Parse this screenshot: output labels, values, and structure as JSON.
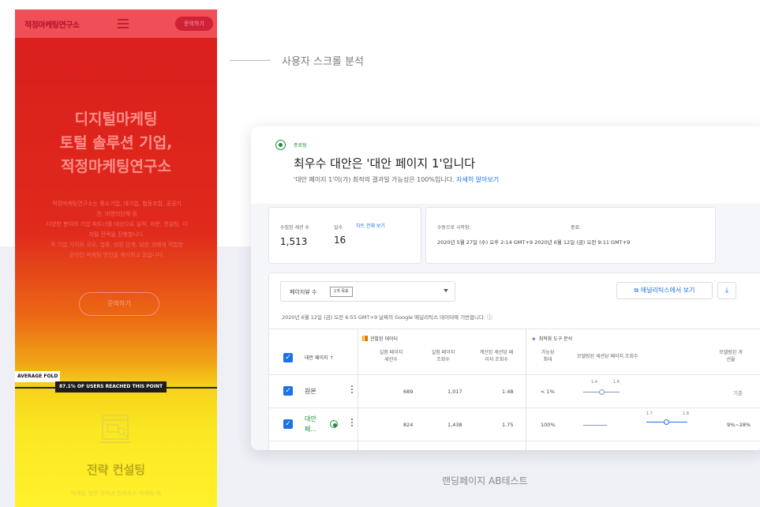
{
  "heatmap": {
    "brand": "적정마케팅연구소",
    "contact_button": "문의하기",
    "hero_lines": [
      "디지털마케팅",
      "토털 솔루션 기업,",
      "적정마케팅연구소"
    ],
    "description_lines": [
      "적정마케팅연구소는 중소기업, 대기업, 협동조합, 공공기",
      "관, 비영리단체 등",
      "다양한 분야의 기업 파트너를 대상으로 실적, 자문, 컨설팅, 디",
      "지털 전략을 진행합니다.",
      "각 기업 가치와 규모, 업종, 성장 단계, 남은 과제에 적합한",
      "온라인 마케팅 방안을 제시하고 있습니다."
    ],
    "hero_button": "문의하기",
    "fold_label": "AVERAGE FOLD",
    "fold_tooltip": "87.1% OF USERS REACHED THIS POINT",
    "fold_reached_percent": 87.1,
    "section_title": "전략 컨설팅",
    "section_sub": "마케팅 업무 전략과 인하우스 마케팅 체"
  },
  "captions": {
    "scroll": "사용자 스크롤 분석",
    "ab": "랜딩페이지 AB테스트"
  },
  "result": {
    "status": "종료됨",
    "headline": "최우수 대안은 '대안 페이지 1'입니다",
    "subtext": "'대안 페이지 1'이(가) 최적의 결과일 가능성은 100%입니다.",
    "learn_more": "자세히 알아보기"
  },
  "stats": {
    "sessions_label": "수집된 세션 수",
    "sessions_value": "1,513",
    "days_label": "일수",
    "days_value": "16",
    "chart_link": "차트 전체 보기",
    "start_label": "수동으로 시작함:",
    "end_label": "종료:",
    "range_text": "2020년 5월 27일 (수) 오후 2:14 GMT+9 2020년 6월 12일 (금) 오전 9:11 GMT+9"
  },
  "table": {
    "dropdown_label": "페이지뷰 수",
    "dropdown_chip": "1개 목표",
    "ga_button": "애널리틱스에서 보기",
    "download_icon": "download-icon",
    "source_note": "2020년 6월 12일 (금) 오전 6:55 GMT+9 날짜의 Google 애널리틱스 데이터에 기반합니다.",
    "group_observed": "관찰된 데이터",
    "group_model": "최적화 도구 분석",
    "col_variant": "대안 페이지",
    "col_exp_sessions": [
      "실험 페이지",
      "세션수"
    ],
    "col_exp_views": [
      "실험 페이지",
      "조회수"
    ],
    "col_views_per_session": [
      "계산된 세션당 페",
      "이지 조회수"
    ],
    "col_prob_best": [
      "가능성",
      "최대"
    ],
    "col_modeled_views": "모델링된 세션당 페이지 조회수",
    "col_modeled_improvement": [
      "모델링된 개",
      "선율"
    ],
    "rows": [
      {
        "name": "원본",
        "sessions": "689",
        "views": "1,017",
        "per_session": "1.48",
        "prob": "< 1%",
        "ci_low": "1.4",
        "ci_high": "1.6",
        "improvement": "기준"
      },
      {
        "name_lines": [
          "대안",
          "페..."
        ],
        "sessions": "824",
        "views": "1,438",
        "per_session": "1.75",
        "prob": "100%",
        "ci_low": "1.7",
        "ci_high": "1.8",
        "improvement": "9%~28%"
      }
    ]
  },
  "colors": {
    "accent": "#1a73e8",
    "success": "#1e8e3e",
    "heat_hot": "#d91d1d",
    "heat_cold": "#fff12c"
  }
}
